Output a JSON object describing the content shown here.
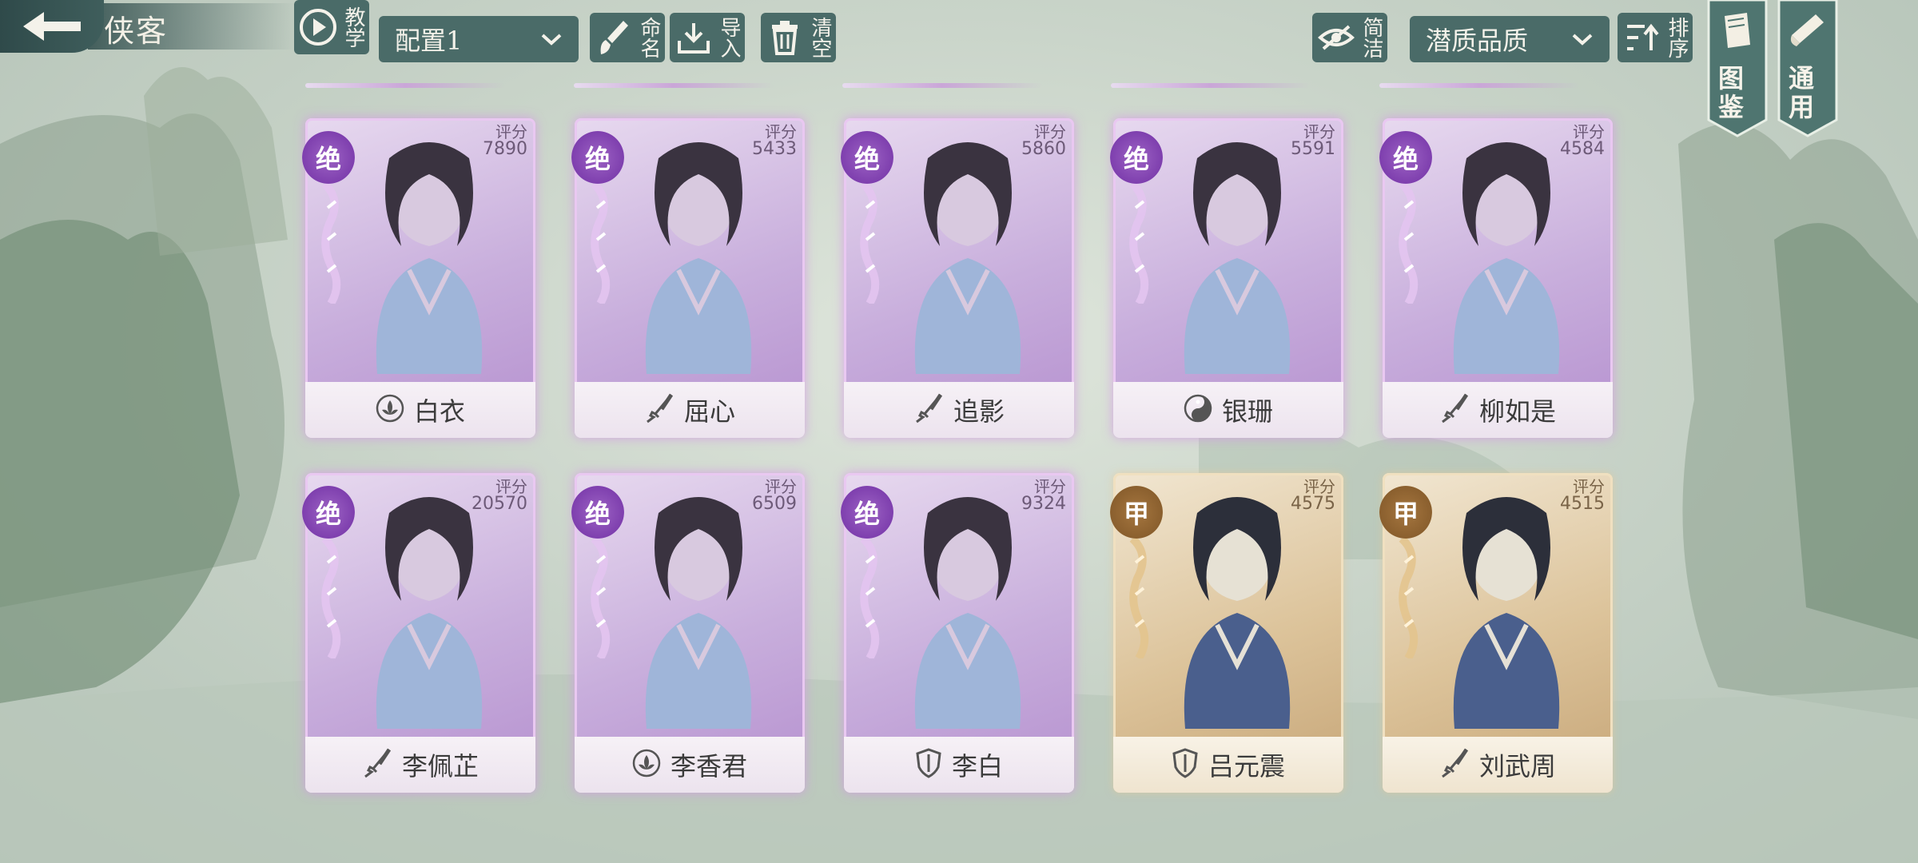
{
  "header": {
    "title": "侠客",
    "teach_label": "教学",
    "config_select": "配置1",
    "name_label": "命名",
    "import_label": "导入",
    "clear_label": "清空",
    "simple_label": "简洁",
    "sort_select": "潜质品质",
    "sort_label": "排序",
    "codex_label": "图鉴",
    "general_label": "通用"
  },
  "score_label": "评分",
  "colors": {
    "purple_accent": "#b590cf",
    "gold_accent": "#c6a577",
    "button_bg": "#4a6b68"
  },
  "cards": [
    {
      "name": "白衣",
      "score": "7890",
      "grade": "绝",
      "rarity": "purple",
      "icon": "lotus-icon"
    },
    {
      "name": "屈心",
      "score": "5433",
      "grade": "绝",
      "rarity": "purple",
      "icon": "sword-icon"
    },
    {
      "name": "追影",
      "score": "5860",
      "grade": "绝",
      "rarity": "purple",
      "icon": "sword-icon"
    },
    {
      "name": "银珊",
      "score": "5591",
      "grade": "绝",
      "rarity": "purple",
      "icon": "yin-yang-icon"
    },
    {
      "name": "柳如是",
      "score": "4584",
      "grade": "绝",
      "rarity": "purple",
      "icon": "sword-icon"
    },
    {
      "name": "李佩芷",
      "score": "20570",
      "grade": "绝",
      "rarity": "purple",
      "icon": "sword-icon"
    },
    {
      "name": "李香君",
      "score": "6509",
      "grade": "绝",
      "rarity": "purple",
      "icon": "lotus-icon"
    },
    {
      "name": "李白",
      "score": "9324",
      "grade": "绝",
      "rarity": "purple",
      "icon": "shield-icon"
    },
    {
      "name": "吕元震",
      "score": "4575",
      "grade": "甲",
      "rarity": "gold",
      "icon": "shield-icon"
    },
    {
      "name": "刘武周",
      "score": "4515",
      "grade": "甲",
      "rarity": "gold",
      "icon": "sword-icon"
    }
  ]
}
